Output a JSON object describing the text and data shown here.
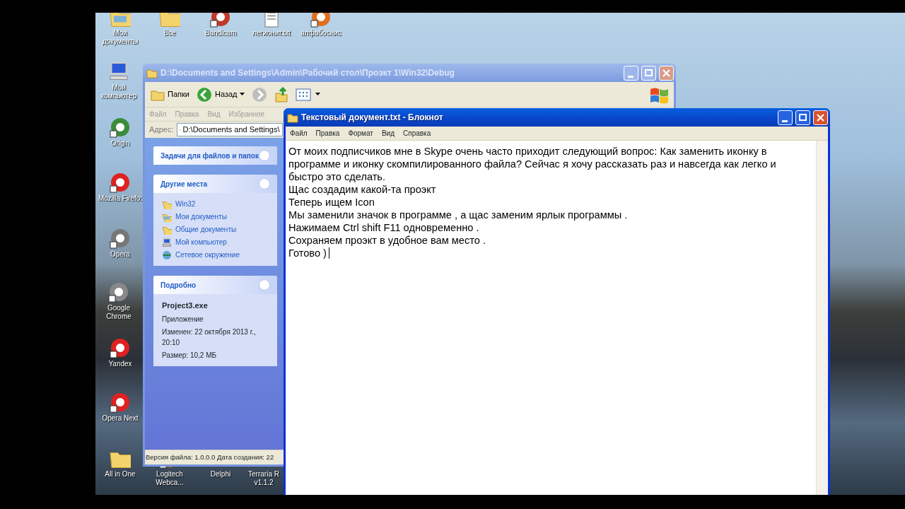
{
  "desktop_icons": [
    {
      "label": "Мои документы",
      "kind": "folder-docs"
    },
    {
      "label": "Все",
      "kind": "folder"
    },
    {
      "label": "Bandicam",
      "kind": "app"
    },
    {
      "label": "легионит.txt",
      "kind": "text-file"
    },
    {
      "label": "алфабоснис",
      "kind": "app"
    },
    {
      "label": "Мой компьютер",
      "kind": "computer"
    },
    {
      "label": "Origin",
      "kind": "app"
    },
    {
      "label": "Mozilla Firefo:",
      "kind": "app"
    },
    {
      "label": "Opera",
      "kind": "app"
    },
    {
      "label": "Google Chrome",
      "kind": "app"
    },
    {
      "label": "Yandex",
      "kind": "app"
    },
    {
      "label": "Opera Next",
      "kind": "app"
    },
    {
      "label": "All in One",
      "kind": "folder"
    },
    {
      "label": "Logitech Webca...",
      "kind": "app"
    },
    {
      "label": "Delphi",
      "kind": "none"
    },
    {
      "label": "Terraria R v1.1.2",
      "kind": "none"
    }
  ],
  "explorer": {
    "title": "D:\\Documents and Settings\\Admin\\Рабочий стол\\Проэкт 1\\Win32\\Debug",
    "active": false,
    "toolbar": [
      {
        "label": "Папки",
        "kind": "folders"
      },
      {
        "label": "Назад",
        "kind": "back"
      },
      {
        "kind": "forward"
      },
      {
        "kind": "up"
      },
      {
        "kind": "views"
      }
    ],
    "menu": [
      "Файл",
      "Правка",
      "Вид",
      "Избранное"
    ],
    "address_label": "Адрес:",
    "address": "D:\\Documents and Settings\\",
    "panels": [
      {
        "title": "Задачи для файлов и папок"
      },
      {
        "title": "Другие места",
        "items": [
          {
            "label": "Win32",
            "kind": "folder"
          },
          {
            "label": "Мои документы",
            "kind": "docs"
          },
          {
            "label": "Общие документы",
            "kind": "folder"
          },
          {
            "label": "Мой компьютер",
            "kind": "computer"
          },
          {
            "label": "Сетевое окружение",
            "kind": "network"
          }
        ]
      },
      {
        "title": "Подробно",
        "details": {
          "name": "Project3.exe",
          "type": "Приложение",
          "modified": "Изменен: 22 октября 2013 г., 20:10",
          "size": "Размер: 10,2 МБ"
        }
      }
    ],
    "status_bar": "Версия файла: 1.0.0.0 Дата создания: 22"
  },
  "notepad": {
    "title": "Текстовый документ.txt - Блокнот",
    "active": true,
    "menu": [
      "Файл",
      "Правка",
      "Формат",
      "Вид",
      "Справка"
    ],
    "lines": [
      "От моих подписчиков мне в Skype очень часто приходит следующий вопрос: Как заменить иконку в программе и иконку скомпилированного файла? Сейчас я хочу рассказать раз и навсегда как легко и быстро это сделать.",
      "Щас создадим какой-та проэкт",
      "Теперь ищем Icon",
      "Мы заменили значок в программе , а щас заменим ярлык программы .",
      "Нажимаем Ctrl shift F11 одновременно .",
      "Сохраняем проэкт в удобное вам место .",
      "Готово )"
    ]
  }
}
